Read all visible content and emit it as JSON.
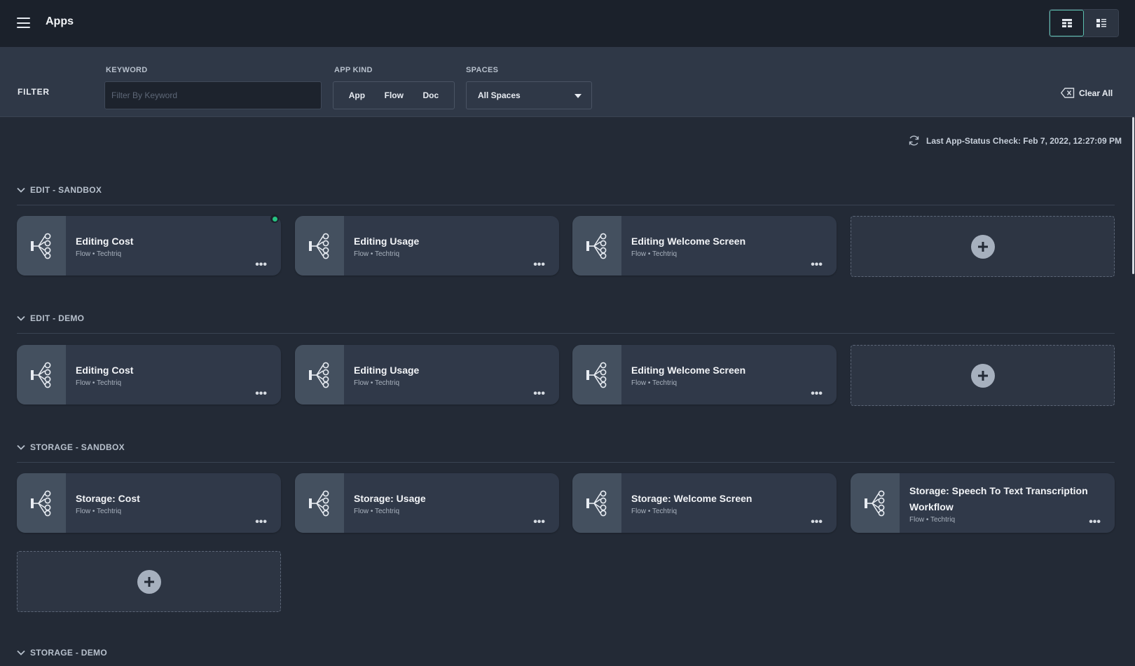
{
  "header": {
    "title": "Apps",
    "menu_icon": "hamburger-icon",
    "view_modes": [
      {
        "name": "grid-view",
        "icon": "grid-icon",
        "active": true
      },
      {
        "name": "list-view",
        "icon": "list-icon",
        "active": false
      }
    ]
  },
  "filter": {
    "label": "FILTER",
    "keyword": {
      "label": "KEYWORD",
      "placeholder": "Filter By Keyword",
      "value": ""
    },
    "app_kind": {
      "label": "APP KIND",
      "options": [
        "App",
        "Flow",
        "Doc"
      ]
    },
    "spaces": {
      "label": "SPACES",
      "selected": "All Spaces"
    },
    "clear_all": "Clear All"
  },
  "status": {
    "text": "Last App-Status Check: Feb 7, 2022, 12:27:09 PM",
    "icon": "refresh-icon"
  },
  "colors": {
    "accent": "#5bbfae",
    "status_ok": "#26c281",
    "card_bg": "#303949",
    "card_icon_bg": "#44505f",
    "page_bg": "#232a36"
  },
  "sections": [
    {
      "title": "EDIT - SANDBOX",
      "cards": [
        {
          "title": "Editing Cost",
          "kind": "Flow",
          "owner": "Techtriq",
          "subtitle": "Flow • Techtriq",
          "status": "running"
        },
        {
          "title": "Editing Usage",
          "kind": "Flow",
          "owner": "Techtriq",
          "subtitle": "Flow • Techtriq"
        },
        {
          "title": "Editing Welcome Screen",
          "kind": "Flow",
          "owner": "Techtriq",
          "subtitle": "Flow • Techtriq"
        }
      ]
    },
    {
      "title": "EDIT - DEMO",
      "cards": [
        {
          "title": "Editing Cost",
          "kind": "Flow",
          "owner": "Techtriq",
          "subtitle": "Flow • Techtriq"
        },
        {
          "title": "Editing Usage",
          "kind": "Flow",
          "owner": "Techtriq",
          "subtitle": "Flow • Techtriq"
        },
        {
          "title": "Editing Welcome Screen",
          "kind": "Flow",
          "owner": "Techtriq",
          "subtitle": "Flow • Techtriq"
        }
      ]
    },
    {
      "title": "STORAGE - SANDBOX",
      "cards": [
        {
          "title": "Storage: Cost",
          "kind": "Flow",
          "owner": "Techtriq",
          "subtitle": "Flow • Techtriq"
        },
        {
          "title": "Storage: Usage",
          "kind": "Flow",
          "owner": "Techtriq",
          "subtitle": "Flow • Techtriq"
        },
        {
          "title": "Storage: Welcome Screen",
          "kind": "Flow",
          "owner": "Techtriq",
          "subtitle": "Flow • Techtriq"
        },
        {
          "title": "Storage: Speech To Text Transcription Workflow",
          "kind": "Flow",
          "owner": "Techtriq",
          "subtitle": "Flow • Techtriq"
        }
      ]
    },
    {
      "title": "STORAGE - DEMO",
      "cards": []
    }
  ]
}
